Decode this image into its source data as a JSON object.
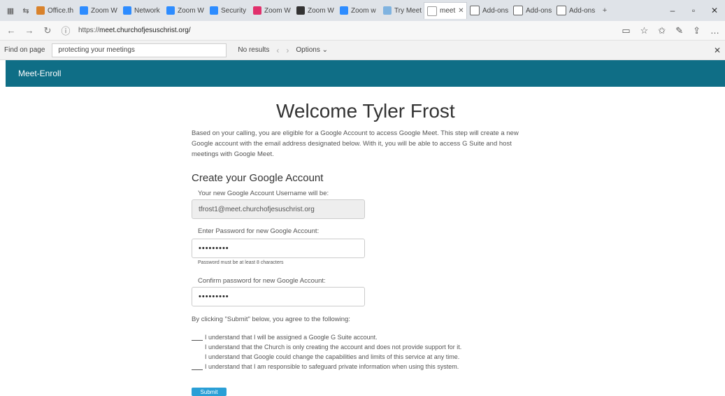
{
  "browser": {
    "tabs": [
      {
        "label": "Office.th",
        "color": "#d9822b"
      },
      {
        "label": "Zoom W",
        "color": "#2d8cff"
      },
      {
        "label": "Network",
        "color": "#2d8cff"
      },
      {
        "label": "Zoom W",
        "color": "#2d8cff"
      },
      {
        "label": "Security",
        "color": "#2d8cff"
      },
      {
        "label": "Zoom W",
        "color": "#e1306c"
      },
      {
        "label": "Zoom W",
        "color": "#333333"
      },
      {
        "label": "Zoom w",
        "color": "#2d8cff"
      },
      {
        "label": "Try Meet",
        "color": "#7fb3e0"
      },
      {
        "label": "meet",
        "color": "#ffffff",
        "active": true
      },
      {
        "label": "Add-ons",
        "color": "#666666"
      },
      {
        "label": "Add-ons",
        "color": "#666666"
      },
      {
        "label": "Add-ons",
        "color": "#666666"
      }
    ],
    "url_prefix": "https://",
    "url_host": "meet.churchofjesuschrist.org/"
  },
  "find_bar": {
    "label": "Find on page",
    "query": "protecting your meetings",
    "result": "No results",
    "options": "Options"
  },
  "site": {
    "brand": "Meet-Enroll"
  },
  "main": {
    "welcome": "Welcome Tyler Frost",
    "intro": "Based on your calling, you are eligible for a Google Account to access Google Meet. This step will create a new Google account with the email address designated below. With it, you will be able to access G Suite and host meetings with Google Meet.",
    "section_title": "Create your Google Account",
    "username_label": "Your new Google Account Username will be:",
    "username_value": "tfrost1@meet.churchofjesuschrist.org",
    "password_label": "Enter Password for new Google Account:",
    "password_value": "•••••••••",
    "password_hint": "Password must be at least 8 characters",
    "confirm_label": "Confirm password for new Google Account:",
    "confirm_value": "•••••••••",
    "agree_text": "By clicking \"Submit\" below, you agree to the following:",
    "acknowledgements": [
      "I understand that I will be assigned a Google G Suite account.",
      "I understand that the Church is only creating the account and does not provide support for it.",
      "I understand that Google could change the capabilities and limits of this service at any time.",
      "I understand that I am responsible to safeguard private information when using this system."
    ],
    "submit_label": "Submit"
  }
}
